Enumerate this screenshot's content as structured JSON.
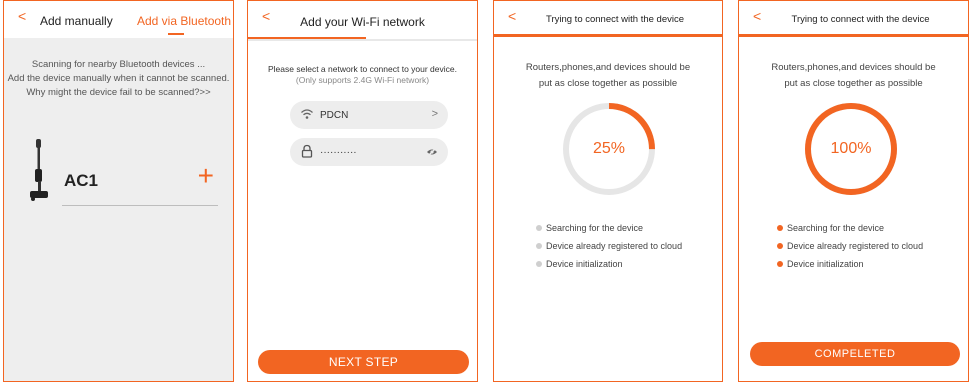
{
  "colors": {
    "accent": "#f26522",
    "panel_bg_gray": "#eeeeee",
    "field_bg": "#ededed",
    "ring_track": "#e6e6e6",
    "dot_inactive": "#cfcfcf"
  },
  "icons": {
    "back": "chevron-left-icon",
    "add": "plus-icon",
    "wifi": "wifi-icon",
    "lock": "lock-icon",
    "eye": "eye-hidden-icon",
    "field_arrow": "chevron-right-icon",
    "device": "vacuum-cleaner-icon"
  },
  "screen1": {
    "back": "<",
    "tabs": [
      {
        "label": "Add manually",
        "active": false
      },
      {
        "label": "Add via Bluetooth",
        "active": true
      }
    ],
    "scan_lines": [
      "Scanning for nearby Bluetooth devices ...",
      "Add the device manually when it cannot be scanned.",
      "Why might the device fail to be scanned?>>"
    ],
    "device": {
      "name": "AC1",
      "add": "+"
    }
  },
  "screen2": {
    "back": "<",
    "title": "Add your Wi-Fi network",
    "instruction": "Please select a network to connect to your device.",
    "instruction_sub": "(Only supports 2.4G Wi-Fi network)",
    "ssid": "PDCN",
    "ssid_arrow": ">",
    "password_masked": "···········",
    "next_button": "NEXT STEP"
  },
  "screen3": {
    "back": "<",
    "title": "Trying to connect with the device",
    "tip_lines": [
      "Routers,phones,and devices should be",
      "put as close together as possible"
    ],
    "progress_value": 25,
    "progress_label": "25%",
    "steps": [
      {
        "label": "Searching for the device",
        "done": false
      },
      {
        "label": "Device already registered to cloud",
        "done": false
      },
      {
        "label": "Device initialization",
        "done": false
      }
    ]
  },
  "screen4": {
    "back": "<",
    "title": "Trying to connect with the device",
    "tip_lines": [
      "Routers,phones,and devices should be",
      "put as close together as possible"
    ],
    "progress_value": 100,
    "progress_label": "100%",
    "steps": [
      {
        "label": "Searching for the device",
        "done": true
      },
      {
        "label": "Device already registered to cloud",
        "done": true
      },
      {
        "label": "Device initialization",
        "done": true
      }
    ],
    "done_button": "COMPELETED"
  }
}
